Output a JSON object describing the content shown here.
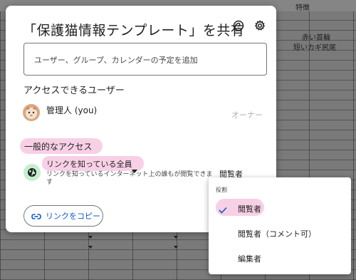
{
  "background_sheet": {
    "header_cells": [
      "特徴"
    ],
    "cells": [
      "赤い首輪",
      "短いカギ尻尾"
    ]
  },
  "dialog": {
    "title": "「保護猫情報テンプレート」を共有",
    "help_icon": "help-circle-icon",
    "settings_icon": "gear-icon",
    "add_people": {
      "placeholder": "ユーザー、グループ、カレンダーの予定を追加"
    },
    "access_section_label": "アクセスできるユーザー",
    "owner": {
      "name": "管理人 (you)",
      "role": "オーナー",
      "avatar_icon": "cat-avatar"
    },
    "general_access_label": "一般的なアクセス",
    "link_access": {
      "icon": "globe-icon",
      "scope": "リンクを知っている全員",
      "description": "リンクを知っているインターネット上の誰もが閲覧できます",
      "role": "閲覧者"
    },
    "copy_link_label": "リンクをコピー",
    "copy_link_icon": "link-icon"
  },
  "role_menu": {
    "header": "役割",
    "items": [
      {
        "label": "閲覧者",
        "selected": true
      },
      {
        "label": "閲覧者（コメント可）",
        "selected": false
      },
      {
        "label": "編集者",
        "selected": false
      }
    ]
  },
  "colors": {
    "highlight": "#f8d0e6",
    "link_blue": "#0b57d0",
    "globe_bg": "#c4eed0",
    "overlay": "#7a7a7a"
  }
}
